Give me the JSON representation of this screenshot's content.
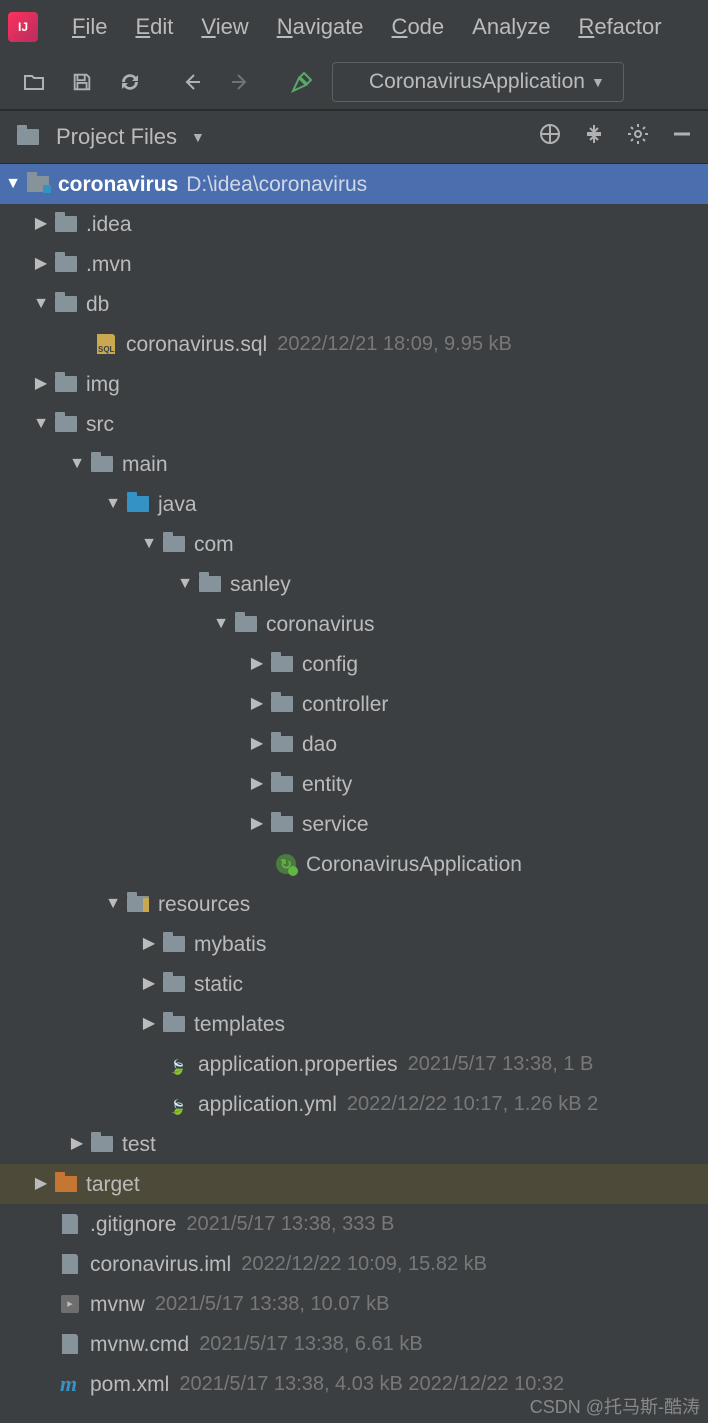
{
  "menu": {
    "file": "File",
    "edit": "Edit",
    "view": "View",
    "navigate": "Navigate",
    "code": "Code",
    "analyze": "Analyze",
    "refactor": "Refactor"
  },
  "run_config": {
    "label": "CoronavirusApplication"
  },
  "toolwindow": {
    "title": "Project Files"
  },
  "tree": {
    "root": {
      "name": "coronavirus",
      "path": "D:\\idea\\coronavirus"
    },
    "idea_dir": ".idea",
    "mvn_dir": ".mvn",
    "db_dir": "db",
    "db_file": {
      "name": "coronavirus.sql",
      "meta": "2022/12/21 18:09, 9.95 kB"
    },
    "img_dir": "img",
    "src_dir": "src",
    "main_dir": "main",
    "java_dir": "java",
    "com_dir": "com",
    "sanley_dir": "sanley",
    "coronavirus_pkg": "coronavirus",
    "config_dir": "config",
    "controller_dir": "controller",
    "dao_dir": "dao",
    "entity_dir": "entity",
    "service_dir": "service",
    "app_class": "CoronavirusApplication",
    "resources_dir": "resources",
    "mybatis_dir": "mybatis",
    "static_dir": "static",
    "templates_dir": "templates",
    "app_props": {
      "name": "application.properties",
      "meta": "2021/5/17 13:38, 1 B"
    },
    "app_yml": {
      "name": "application.yml",
      "meta": "2022/12/22 10:17, 1.26 kB 2"
    },
    "test_dir": "test",
    "target_dir": "target",
    "gitignore": {
      "name": ".gitignore",
      "meta": "2021/5/17 13:38, 333 B"
    },
    "iml": {
      "name": "coronavirus.iml",
      "meta": "2022/12/22 10:09, 15.82 kB"
    },
    "mvnw": {
      "name": "mvnw",
      "meta": "2021/5/17 13:38, 10.07 kB"
    },
    "mvnw_cmd": {
      "name": "mvnw.cmd",
      "meta": "2021/5/17 13:38, 6.61 kB"
    },
    "pom": {
      "name": "pom.xml",
      "meta": "2021/5/17 13:38, 4.03 kB 2022/12/22 10:32"
    }
  },
  "watermark": "CSDN @托马斯-酷涛"
}
